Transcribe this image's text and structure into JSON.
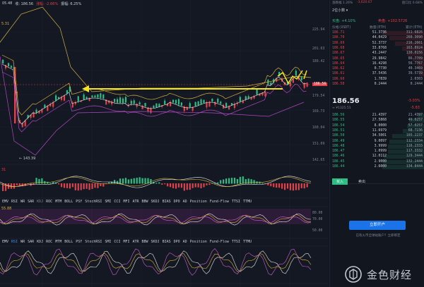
{
  "top_info": {
    "prefix": "05.48",
    "close_label": "收: 186.56",
    "change_label": "涨幅: -2.66%",
    "amp_label": "振幅: 6.25%"
  },
  "chart_data": {
    "type": "candlestick",
    "price_ticks": [
      "225.94",
      "201.63",
      "189.42",
      "179.54",
      "169.73",
      "160.04",
      "151.09",
      "142.65"
    ],
    "current_price_tag": "186.56",
    "low_marker": "← 143.39",
    "ma_value_tag": "5.31"
  },
  "panes": {
    "vol_val": "31",
    "macd_val": "55.88",
    "rsi_ticks": [
      "80.00",
      "70.00",
      "50.00"
    ]
  },
  "indicator_bar": [
    "EMV",
    "RSI",
    "WR",
    "SAR",
    "KDJ",
    "ROC",
    "MTM",
    "BOLL",
    "PSY",
    "StochRSI",
    "SMI",
    "CCI",
    "MFI",
    "ATR",
    "BBW",
    "SKDJ",
    "BIAS",
    "DPO",
    "AD",
    "Position",
    "Fund-Flow",
    "TTSI",
    "TTMU"
  ],
  "side": {
    "header_left": "涨跌幅 1.26%",
    "header_center": "-3,620.67",
    "header_right": "盘口比 0.68%",
    "tab": "2位小数",
    "buy_ratio": "买盘: +4.10%",
    "sell_ratio": "卖盘: +102.5726",
    "col_price": "价格(USDT)",
    "col_amount": "数量(ETH)",
    "col_total": "累计(ETH)",
    "asks": [
      {
        "p": "186.71",
        "a": "51.3736",
        "t": "311.6826"
      },
      {
        "p": "186.70",
        "a": "44.0429",
        "t": "260.3090"
      },
      {
        "p": "186.69",
        "a": "52.3737",
        "t": "216.2661"
      },
      {
        "p": "186.68",
        "a": "33.8768",
        "t": "163.8924"
      },
      {
        "p": "186.67",
        "a": "43.2447",
        "t": "130.0156"
      },
      {
        "p": "186.65",
        "a": "29.9842",
        "t": "86.7709"
      },
      {
        "p": "186.64",
        "a": "16.4298",
        "t": "56.7767"
      },
      {
        "p": "186.62",
        "a": "0.7730",
        "t": "40.3469"
      },
      {
        "p": "186.61",
        "a": "37.5436",
        "t": "39.5739"
      },
      {
        "p": "186.60",
        "a": "1.7839",
        "t": "2.0303"
      },
      {
        "p": "186.58",
        "a": "0.2444",
        "t": "0.2444"
      }
    ],
    "last_price": "186.56",
    "last_change": "-3.03%",
    "sub_price": "≈ ¥1325.51",
    "sub_change": "-5.83",
    "bids": [
      {
        "p": "186.56",
        "a": "21.4397",
        "t": "21.4397"
      },
      {
        "p": "186.55",
        "a": "27.5868",
        "t": "49.0257"
      },
      {
        "p": "186.54",
        "a": "8.0000",
        "t": "57.0257"
      },
      {
        "p": "186.51",
        "a": "11.6979",
        "t": "68.7236"
      },
      {
        "p": "186.50",
        "a": "34.5001",
        "t": "103.2237"
      },
      {
        "p": "186.49",
        "a": "9.0097",
        "t": "112.2334"
      },
      {
        "p": "186.48",
        "a": "3.9999",
        "t": "116.2333"
      },
      {
        "p": "186.47",
        "a": "1.0999",
        "t": "117.3332"
      },
      {
        "p": "186.46",
        "a": "12.0112",
        "t": "129.3444"
      },
      {
        "p": "186.45",
        "a": "2.9000",
        "t": "132.2444"
      },
      {
        "p": "186.44",
        "a": "2.6000",
        "t": "134.8444"
      }
    ],
    "tab_buy": "买入",
    "tab_sell": "卖出",
    "open_account": "立即开户",
    "notice": "已有火币全球站账户？立即绑定",
    "brand": "金色财经"
  },
  "colors": {
    "up": "#2dbd85",
    "down": "#e0414a",
    "accent": "#1a73e8",
    "bg": "#141822"
  }
}
